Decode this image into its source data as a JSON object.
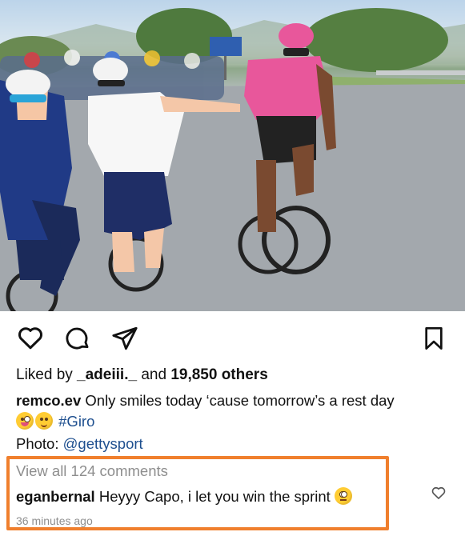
{
  "post": {
    "likes": {
      "prefix": "Liked by ",
      "user": "_adeiii._",
      "middle": " and ",
      "count": "19,850 others"
    },
    "caption": {
      "username": "remco.ev",
      "text": "Only smiles today ‘cause tomorrow’s a rest day",
      "emojis": [
        "zany-face-emoji",
        "sleepy-face-emoji"
      ],
      "hashtag": "#Giro",
      "photo_label": "Photo: ",
      "photo_credit": "@gettysport"
    },
    "comments": {
      "view_all": "View all 124 comments",
      "top_comment": {
        "username": "eganbernal",
        "text": "Heyyy Capo, i let you win the sprint",
        "emoji": "face-with-rolling-eyes-emoji",
        "time": "36 minutes ago"
      }
    }
  },
  "icons": {
    "like": "heart-icon",
    "comment": "comment-bubble-icon",
    "share": "paper-plane-icon",
    "save": "bookmark-icon",
    "comment_like": "small-heart-icon"
  },
  "colors": {
    "link": "#1e4f8f",
    "highlight_border": "#f07f2d",
    "muted_text": "#8e8e8e"
  }
}
